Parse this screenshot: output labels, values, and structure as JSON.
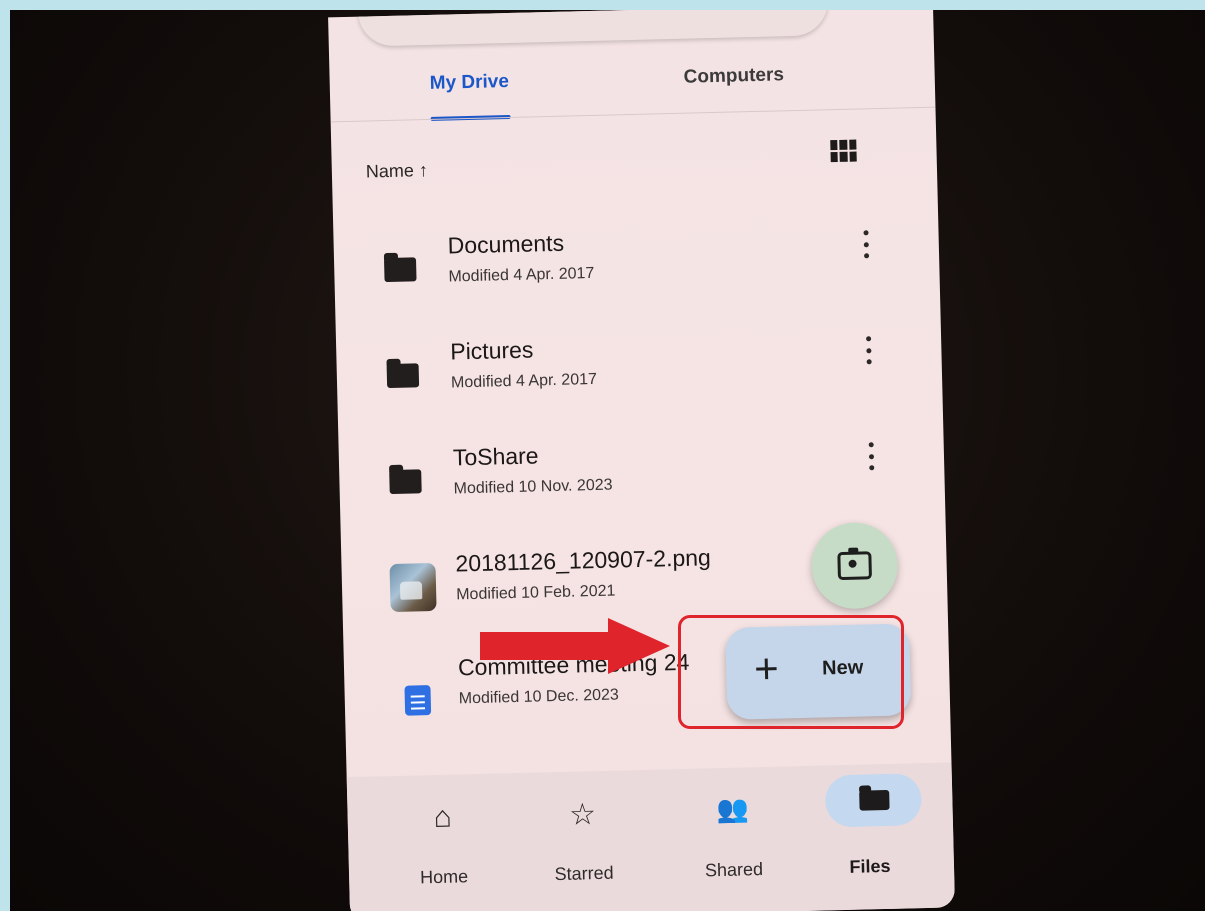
{
  "tabs": [
    {
      "label": "My Drive",
      "selected": true
    },
    {
      "label": "Computers",
      "selected": false
    }
  ],
  "sort": {
    "label": "Name ↑"
  },
  "files": [
    {
      "name": "Documents",
      "meta": "Modified 4 Apr. 2017",
      "kind": "folder"
    },
    {
      "name": "Pictures",
      "meta": "Modified 4 Apr. 2017",
      "kind": "folder"
    },
    {
      "name": "ToShare",
      "meta": "Modified 10 Nov. 2023",
      "kind": "folder"
    },
    {
      "name": "20181126_120907-2.png",
      "meta": "Modified 10 Feb. 2021",
      "kind": "image"
    },
    {
      "name": "Committee meeting 24",
      "meta": "Modified 10 Dec. 2023",
      "kind": "doc"
    }
  ],
  "fab": {
    "new_label": "New",
    "plus": "+",
    "camera_icon": "camera-icon"
  },
  "nav": [
    {
      "label": "Home",
      "icon": "home-icon",
      "glyph": "⌂"
    },
    {
      "label": "Starred",
      "icon": "star-icon",
      "glyph": "☆"
    },
    {
      "label": "Shared",
      "icon": "people-icon",
      "glyph": "👥"
    },
    {
      "label": "Files",
      "icon": "folder-icon",
      "selected": true
    }
  ],
  "colors": {
    "accent": "#1b57c9",
    "annotation": "#e0242c",
    "fab_new": "#c5d6ea",
    "fab_camera": "#c7dcc7"
  }
}
